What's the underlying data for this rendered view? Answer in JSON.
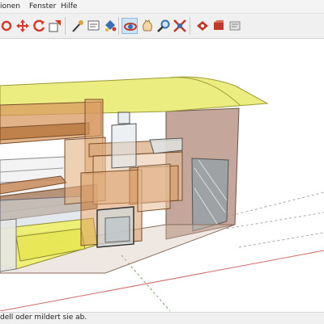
{
  "menu": {
    "items": [
      "ionen",
      "Fenster",
      "Hilfe"
    ]
  },
  "toolbar": {
    "tools": [
      {
        "icon": "circle-tool-icon",
        "color": "#d33b2c"
      },
      {
        "icon": "move-icon",
        "color": "#d33b2c"
      },
      {
        "icon": "rotate-icon",
        "color": "#d33b2c"
      },
      {
        "icon": "scale-icon",
        "color": "#d33b2c"
      },
      {
        "icon": "tape-measure-icon",
        "color": "#8a6d2d"
      },
      {
        "icon": "text-tool-icon",
        "color": "#666666"
      },
      {
        "icon": "paint-bucket-icon",
        "color": "#3a6fb6"
      },
      {
        "icon": "orbit-icon",
        "color": "#c0392b",
        "active": true
      },
      {
        "icon": "pan-hand-icon",
        "color": "#d9a441"
      },
      {
        "icon": "zoom-icon",
        "color": "#3a6fb6"
      },
      {
        "icon": "zoom-extents-icon",
        "color": "#c0392b"
      },
      {
        "icon": "warehouse-icon",
        "color": "#c0392b"
      },
      {
        "icon": "components-icon",
        "color": "#c0392b"
      },
      {
        "icon": "extension-icon",
        "color": "#888888"
      }
    ]
  },
  "status": {
    "text": "dell oder mildert sie ab."
  },
  "colors": {
    "roof_yellow": "#e8ea6a",
    "wall_brown": "#b08a78",
    "wood": "#d89a62",
    "glass": "#cfd8de",
    "axis_red": "#d06a6a"
  }
}
